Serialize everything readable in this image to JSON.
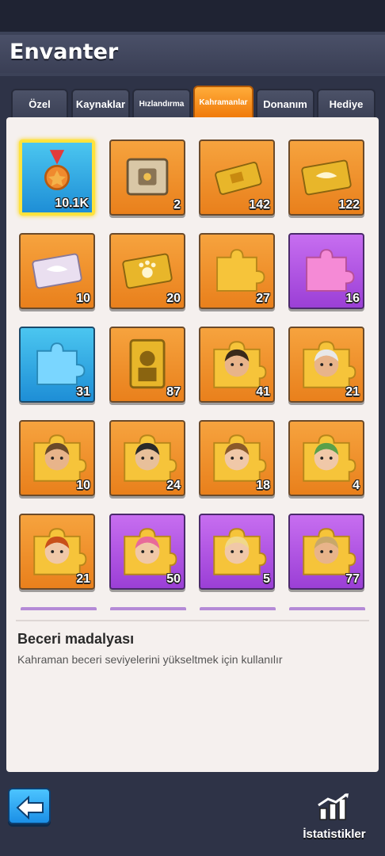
{
  "header": {
    "title": "Envanter"
  },
  "tabs": [
    {
      "label": "Özel"
    },
    {
      "label": "Kaynaklar"
    },
    {
      "label": "Hızlandırma"
    },
    {
      "label": "Kahramanlar",
      "active": true
    },
    {
      "label": "Donanım"
    },
    {
      "label": "Hediye"
    }
  ],
  "items": [
    {
      "icon": "medal-icon",
      "count": "10.1K",
      "bg": "blue",
      "selected": true
    },
    {
      "icon": "supply-crate-icon",
      "count": "2",
      "bg": "orange"
    },
    {
      "icon": "gold-card-icon",
      "count": "142",
      "bg": "orange"
    },
    {
      "icon": "gold-wing-card-icon",
      "count": "122",
      "bg": "orange"
    },
    {
      "icon": "silver-wing-card-icon",
      "count": "10",
      "bg": "orange"
    },
    {
      "icon": "gold-paw-card-icon",
      "count": "20",
      "bg": "orange"
    },
    {
      "icon": "gold-puzzle-icon",
      "count": "27",
      "bg": "orange"
    },
    {
      "icon": "pink-puzzle-icon",
      "count": "16",
      "bg": "purple"
    },
    {
      "icon": "blue-puzzle-icon",
      "count": "31",
      "bg": "blue"
    },
    {
      "icon": "gold-hero-frame-icon",
      "count": "87",
      "bg": "orange"
    },
    {
      "icon": "hero-puzzle-bearded-icon",
      "count": "41",
      "bg": "orange"
    },
    {
      "icon": "hero-puzzle-elder-icon",
      "count": "21",
      "bg": "orange"
    },
    {
      "icon": "hero-puzzle-longhair-icon",
      "count": "10",
      "bg": "orange"
    },
    {
      "icon": "hero-puzzle-soldier-icon",
      "count": "24",
      "bg": "orange"
    },
    {
      "icon": "hero-puzzle-woman-icon",
      "count": "18",
      "bg": "orange"
    },
    {
      "icon": "hero-puzzle-green-hair-icon",
      "count": "4",
      "bg": "orange"
    },
    {
      "icon": "hero-puzzle-redhead-icon",
      "count": "21",
      "bg": "orange"
    },
    {
      "icon": "hero-puzzle-pink-hair-icon",
      "count": "50",
      "bg": "purple"
    },
    {
      "icon": "hero-puzzle-blonde-icon",
      "count": "5",
      "bg": "purple"
    },
    {
      "icon": "hero-puzzle-explorer-icon",
      "count": "77",
      "bg": "purple"
    }
  ],
  "description": {
    "title": "Beceri madalyası",
    "text": "Kahraman beceri seviyelerini yükseltmek için kullanılır"
  },
  "footer": {
    "stats_label": "İstatistikler"
  },
  "colors": {
    "accent": "#f07a0a",
    "selected_border": "#ffe33c",
    "panel": "#f5f0ee"
  }
}
